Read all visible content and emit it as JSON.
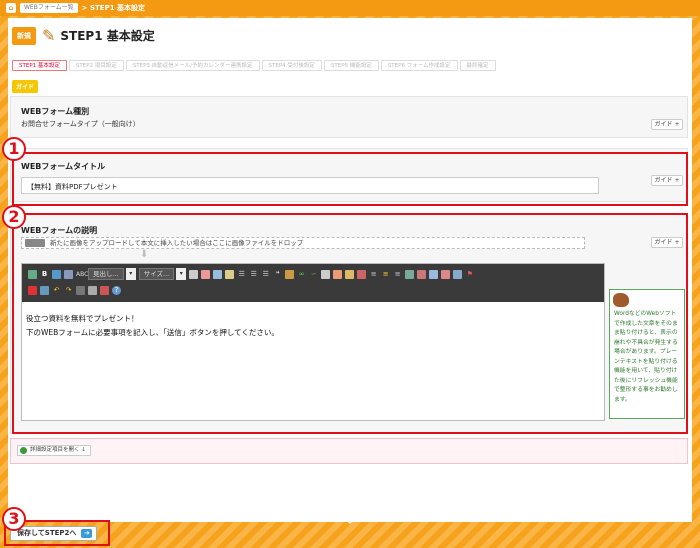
{
  "topbar": {
    "home_icon": "home-icon",
    "crumb": "WEBフォーム一覧",
    "current": "> STEP1 基本設定"
  },
  "header": {
    "new_badge": "新規",
    "title": "STEP1 基本設定",
    "icon": "pencil-icon"
  },
  "steps": [
    "STEP1 基本設定",
    "STEP2 項目設定",
    "STEP3 自動返信メール/予約カレンダー連携設定",
    "STEP4 受付後設定",
    "STEP5 機能設定",
    "STEP6 フォーム作成設定",
    "最終確定"
  ],
  "guide_tag": "ガイド",
  "guide_button": "ガイド +",
  "form_type": {
    "label": "WEBフォーム種別",
    "value": "お問合せフォームタイプ（一般向け）"
  },
  "form_title": {
    "label": "WEBフォームタイトル",
    "value": "【無料】資料PDFプレゼント"
  },
  "form_desc": {
    "label": "WEBフォームの説明",
    "drop_text": "新たに画像をアップロードして本文に挿入したい場合はここに画像ファイルをドロップ",
    "heading_select": "見出し...",
    "size_select": "サイズ...",
    "content_line1": "役立つ資料を無料でプレゼント！",
    "content_line2": "下のWEBフォームに必要事項を記入し、「送信」ボタンを押してください。",
    "tip": "WordなどのWebソフトで作成した文章をそのまま貼り付けると、表示の崩れや不具合が発生する場合があります。プレーンテキストを貼り付ける機能を用いて、貼り付けた後にリフレッシュ機能で整形する事をお勧めします。"
  },
  "detail_button": "詳細設定項目を開く ↓",
  "save_button": "保存してSTEP2へ",
  "annotations": [
    "1",
    "2",
    "3"
  ],
  "colors": {
    "orange": "#f39a12",
    "annotation_red": "#e0101a",
    "toolbar_dark": "#3a3a3a"
  }
}
